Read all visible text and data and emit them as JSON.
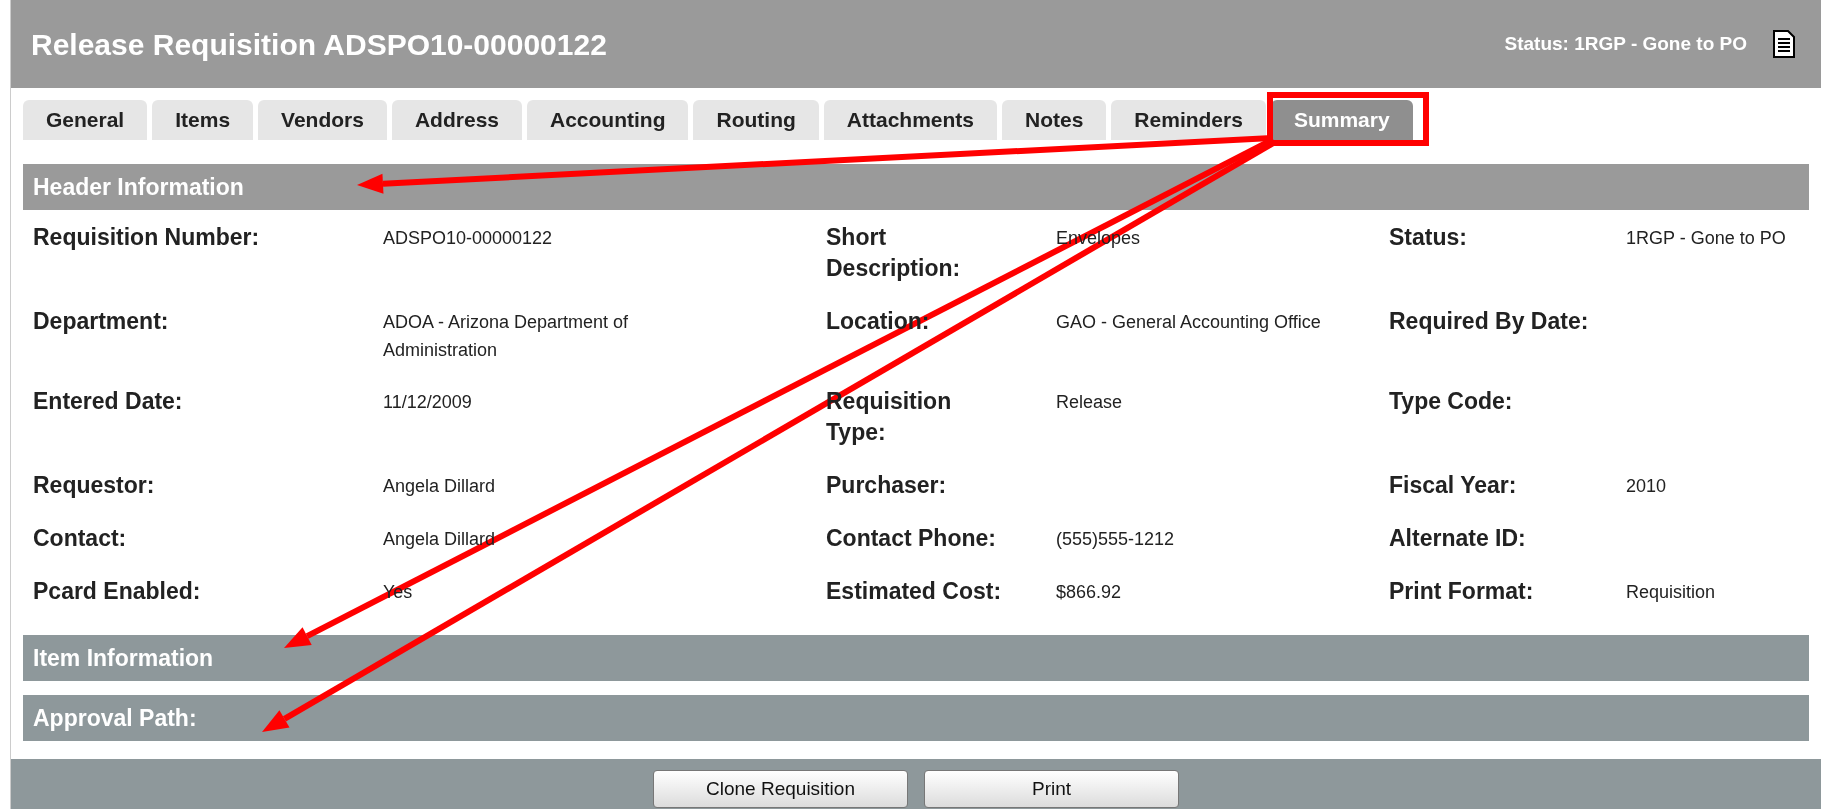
{
  "window": {
    "title": "Release Requisition ADSPO10-00000122",
    "status": "Status: 1RGP - Gone to PO"
  },
  "tabs": [
    {
      "label": "General",
      "selected": false
    },
    {
      "label": "Items",
      "selected": false
    },
    {
      "label": "Vendors",
      "selected": false
    },
    {
      "label": "Address",
      "selected": false
    },
    {
      "label": "Accounting",
      "selected": false
    },
    {
      "label": "Routing",
      "selected": false
    },
    {
      "label": "Attachments",
      "selected": false
    },
    {
      "label": "Notes",
      "selected": false
    },
    {
      "label": "Reminders",
      "selected": false
    },
    {
      "label": "Summary",
      "selected": true
    }
  ],
  "sections": [
    {
      "title": "Header Information",
      "kind": "fields",
      "rows": [
        [
          {
            "label": "Requisition Number:",
            "value": "ADSPO10-00000122"
          },
          {
            "label": "Short Description:",
            "value": "Envelopes"
          },
          {
            "label": "Status:",
            "value": "1RGP - Gone to PO"
          }
        ],
        [
          {
            "label": "Department:",
            "value": "ADOA - Arizona Department of Administration"
          },
          {
            "label": "Location:",
            "value": "GAO - General Accounting Office"
          },
          {
            "label": "Required By Date:"
          }
        ],
        [
          {
            "label": "Entered Date:",
            "value": "11/12/2009"
          },
          {
            "label": "Requisition Type:",
            "value": "Release"
          },
          {
            "label": "Type Code:"
          }
        ],
        [
          {
            "label": "Requestor:",
            "value": "Angela Dillard"
          },
          {
            "label": "Purchaser:"
          },
          {
            "label": "Fiscal Year:",
            "value": "2010"
          }
        ],
        [
          {
            "label": "Contact:",
            "value": "Angela Dillard"
          },
          {
            "label": "Contact Phone:",
            "value": "(555)555-1212"
          },
          {
            "label": "Alternate ID:"
          }
        ],
        [
          {
            "label": "Pcard Enabled:",
            "value": "Yes"
          },
          {
            "label": "Estimated Cost:",
            "value": "$866.92"
          },
          {
            "label": "Print Format:",
            "value": "Requisition"
          }
        ]
      ]
    },
    {
      "title": "Item Information",
      "kind": "bar"
    },
    {
      "title": "Approval Path:",
      "kind": "bar"
    }
  ],
  "buttons": [
    "Clone Requisition",
    "Print"
  ]
}
